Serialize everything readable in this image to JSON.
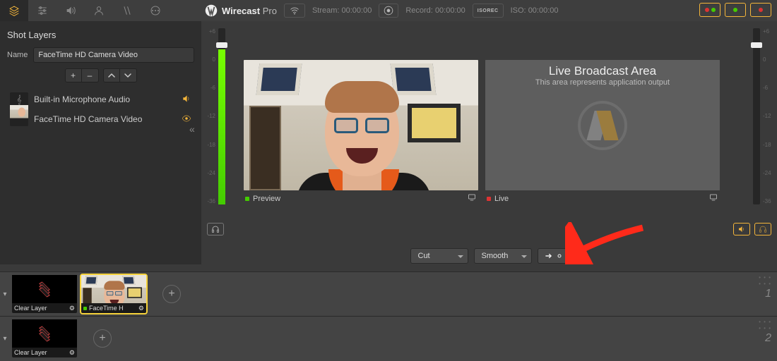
{
  "app": {
    "name": "Wirecast",
    "edition": "Pro"
  },
  "topbar": {
    "stream_label": "Stream:",
    "stream_time": "00:00:00",
    "record_label": "Record:",
    "record_time": "00:00:00",
    "iso_label": "ISO:",
    "iso_time": "00:00:00",
    "iso_box_top": "ISO",
    "iso_box_bottom": "REC"
  },
  "panel": {
    "title": "Shot Layers",
    "name_label": "Name",
    "name_value": "FaceTime HD Camera Video",
    "btn_add": "+",
    "btn_remove": "–",
    "items": [
      {
        "label": "Built-in Microphone Audio"
      },
      {
        "label": "FaceTime HD Camera Video"
      }
    ]
  },
  "meter": {
    "ticks": [
      "+6",
      "0",
      "-6",
      "-12",
      "-18",
      "-24",
      "-36"
    ]
  },
  "preview": {
    "label": "Preview"
  },
  "live": {
    "label": "Live",
    "heading": "Live Broadcast Area",
    "sub": "This area represents application output"
  },
  "transition": {
    "cut": "Cut",
    "smooth": "Smooth"
  },
  "rows": [
    {
      "num": "1",
      "shots": [
        {
          "label": "Clear Layer",
          "kind": "clear"
        },
        {
          "label": "FaceTime H",
          "kind": "camera",
          "selected": true
        }
      ]
    },
    {
      "num": "2",
      "shots": [
        {
          "label": "Clear Layer",
          "kind": "clear"
        }
      ]
    }
  ]
}
